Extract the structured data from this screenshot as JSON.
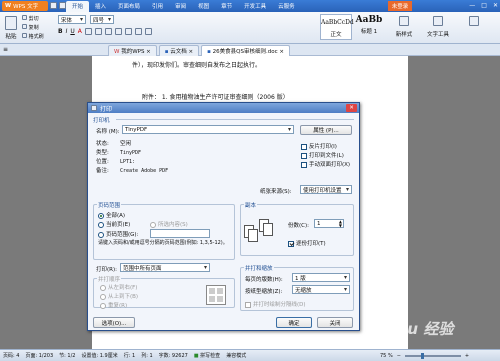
{
  "titlebar": {
    "app": "WPS 文字",
    "menus": [
      "开始",
      "插入",
      "页面布局",
      "引用",
      "审阅",
      "视图",
      "章节",
      "开发工具",
      "云服务"
    ],
    "login": "未登录"
  },
  "toolbar": {
    "paste": "粘贴",
    "cut": "剪切",
    "copy": "复制",
    "format_painter": "格式刷",
    "font": "宋体",
    "size": "四号",
    "styles": [
      "AaBbCcDd",
      "AaBb"
    ],
    "style_labels": [
      "正文",
      "标题 1"
    ],
    "new_style": "新样式",
    "text_tools": "文字工具"
  },
  "tabs": [
    {
      "label": "我的WPS"
    },
    {
      "label": "云文档"
    },
    {
      "label": "26美食县QS审核细则.doc"
    }
  ],
  "document": {
    "line1": "件），现印发你们。审查细则自发布之日起执行。",
    "line2": "附件：   1. 食用植物油生产许可证审查细则（2006 版）"
  },
  "dialog": {
    "title": "打印",
    "printer_section": "打印机",
    "name_label": "名称 (M):",
    "name_value": "TinyPDF",
    "properties": "属性 (P)...",
    "status_label": "状态:",
    "status_value": "空闲",
    "type_label": "类型:",
    "type_value": "TinyPDF",
    "location_label": "位置:",
    "location_value": "LPT1:",
    "comment_label": "备注:",
    "comment_value": "Create Adobe PDF",
    "reverse_print": "反片打印(I)",
    "print_to_file": "打印到文件(L)",
    "manual_duplex": "手动双面打印(X)",
    "paper_source_label": "纸张来源(S):",
    "paper_source_value": "使用打印机设置",
    "range_section": "页码范围",
    "all": "全部(A)",
    "current_page": "当前页(E)",
    "selection": "所选内容(S)",
    "page_range": "页码范围(G):",
    "range_hint": "请键入页码和/或用逗号分隔的页码范围(例如: 1,3,5-12)。",
    "print_label": "打印(R):",
    "print_value": "范围中所有页面",
    "order_title": "并打顺序",
    "order_ltr": "从左到右(F)",
    "order_ttb": "从上到下(B)",
    "order_repeat": "重复(R)",
    "copies_section": "副本",
    "copies_label": "份数(C):",
    "copies_value": "1",
    "collate": "逐份打印(T)",
    "zoom_section": "并打和缩放",
    "pages_per_sheet_label": "每页的版数(H):",
    "pages_per_sheet_value": "1 版",
    "scale_label": "按纸型缩放(Z):",
    "scale_value": "无缩放",
    "draw_border": "并打时绘制分隔线(D)",
    "options": "选项(O)...",
    "ok": "确定",
    "close": "关闭"
  },
  "statusbar": {
    "page": "页码: 4",
    "pages": "页面: 1/203",
    "section": "节: 1/2",
    "setting": "设置值: 1.9厘米",
    "row": "行: 1",
    "col": "列: 1",
    "words": "字数: 92627",
    "spell": "拼写检查",
    "mode": "兼容模式",
    "zoom": "75 %"
  },
  "watermark": "Baidu 经验"
}
